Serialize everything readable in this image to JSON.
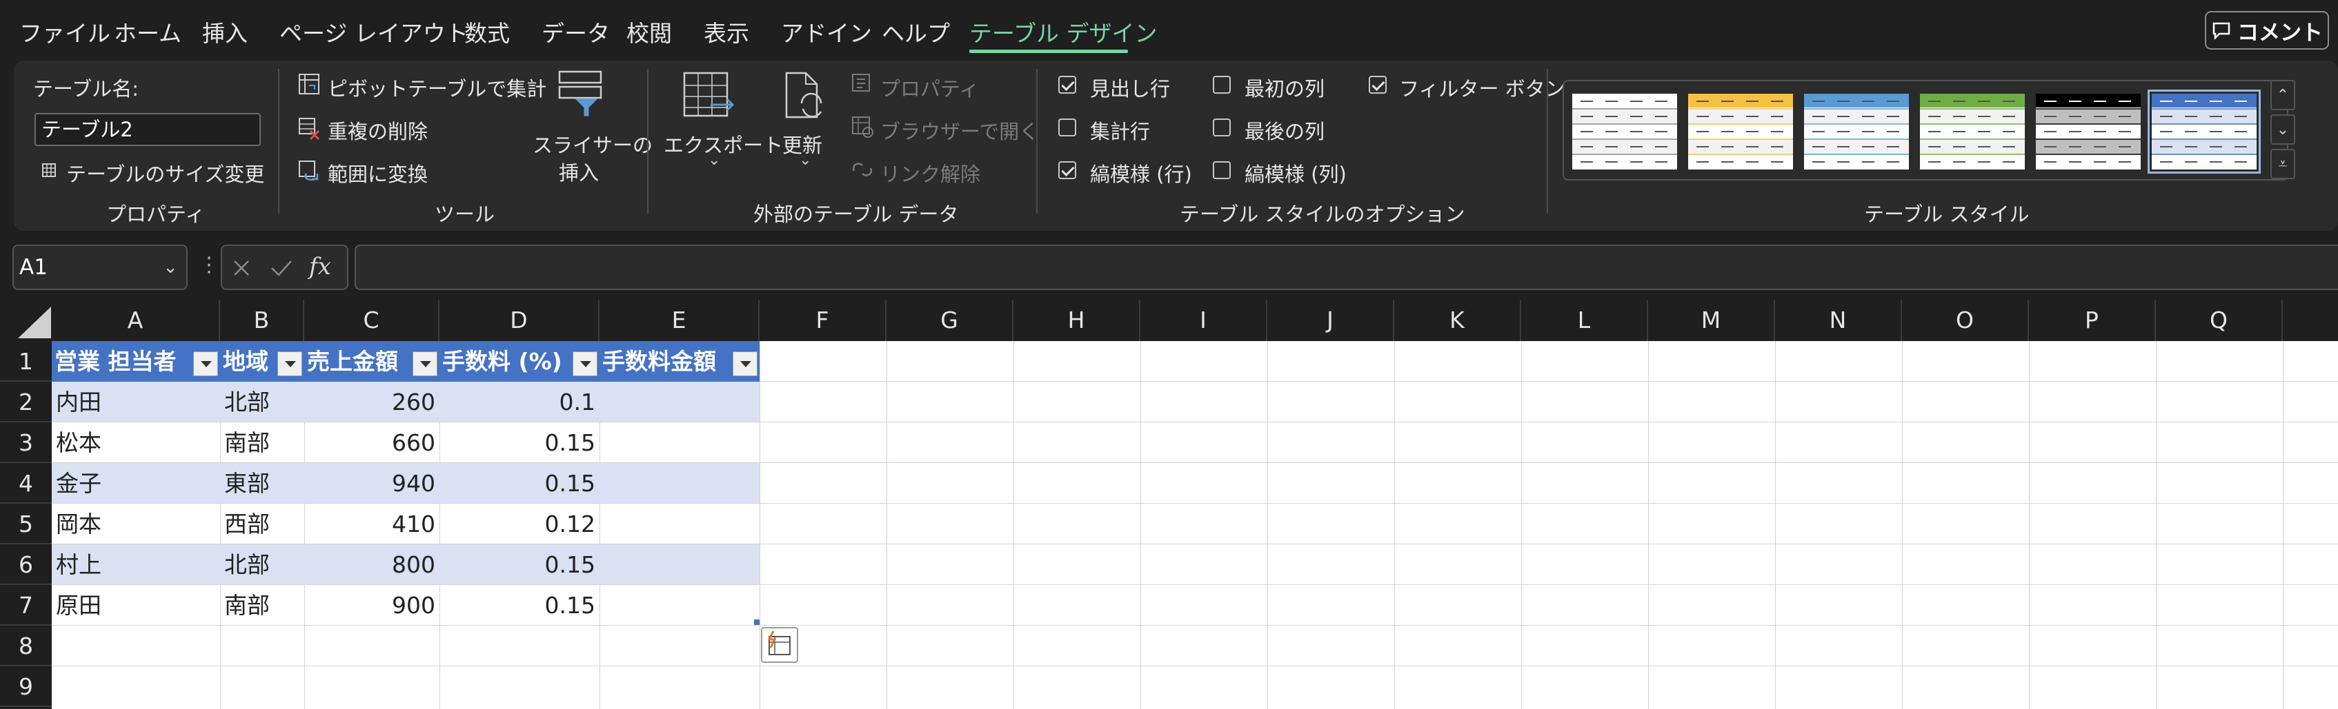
{
  "menu": {
    "tabs": [
      "ファイル",
      "ホーム",
      "挿入",
      "ページ レイアウト",
      "数式",
      "データ",
      "校閲",
      "表示",
      "アドイン",
      "ヘルプ",
      "テーブル デザイン"
    ],
    "active_tab": "テーブル デザイン",
    "comment_label": "コメント"
  },
  "ribbon": {
    "properties": {
      "table_name_label": "テーブル名:",
      "table_name_value": "テーブル2",
      "resize_label": "テーブルのサイズ変更",
      "group_label": "プロパティ"
    },
    "tools": {
      "pivot_label": "ピボットテーブルで集計",
      "remove_dup_label": "重複の削除",
      "convert_label": "範囲に変換",
      "slicer_label_1": "スライサーの",
      "slicer_label_2": "挿入",
      "group_label": "ツール"
    },
    "external": {
      "export_label": "エクスポート",
      "refresh_label": "更新",
      "properties_label": "プロパティ",
      "browser_label": "ブラウザーで開く",
      "unlink_label": "リンク解除",
      "group_label": "外部のテーブル データ"
    },
    "style_options": {
      "header_row": {
        "label": "見出し行",
        "checked": true
      },
      "total_row": {
        "label": "集計行",
        "checked": false
      },
      "banded_rows": {
        "label": "縞模様 (行)",
        "checked": true
      },
      "first_column": {
        "label": "最初の列",
        "checked": false
      },
      "last_column": {
        "label": "最後の列",
        "checked": false
      },
      "banded_columns": {
        "label": "縞模様 (列)",
        "checked": false
      },
      "filter_button": {
        "label": "フィルター ボタン",
        "checked": true
      },
      "group_label": "テーブル スタイルのオプション"
    },
    "table_styles": {
      "group_label": "テーブル スタイル",
      "swatch_colors": [
        "#8a8a8a",
        "#f5c043",
        "#5b9bd5",
        "#70ad47",
        "#000000",
        "#4472c4"
      ],
      "selected_index": 5
    }
  },
  "formula_bar": {
    "name_box": "A1",
    "formula": ""
  },
  "grid": {
    "columns": [
      "A",
      "B",
      "C",
      "D",
      "E",
      "F",
      "G",
      "H",
      "I",
      "J",
      "K",
      "L",
      "M",
      "N",
      "O",
      "P",
      "Q"
    ],
    "rows": [
      "1",
      "2",
      "3",
      "4",
      "5",
      "6",
      "7",
      "8",
      "9"
    ],
    "table_headers": [
      "営業 担当者",
      "地域",
      "売上金額",
      "手数料 (%)",
      "手数料金額"
    ],
    "table_rows": [
      [
        "内田",
        "北部",
        "260",
        "0.1",
        ""
      ],
      [
        "松本",
        "南部",
        "660",
        "0.15",
        ""
      ],
      [
        "金子",
        "東部",
        "940",
        "0.15",
        ""
      ],
      [
        "岡本",
        "西部",
        "410",
        "0.12",
        ""
      ],
      [
        "村上",
        "北部",
        "800",
        "0.15",
        ""
      ],
      [
        "原田",
        "南部",
        "900",
        "0.15",
        ""
      ]
    ],
    "header_color": "#4472c4",
    "band_color": "#d9e1f2"
  }
}
